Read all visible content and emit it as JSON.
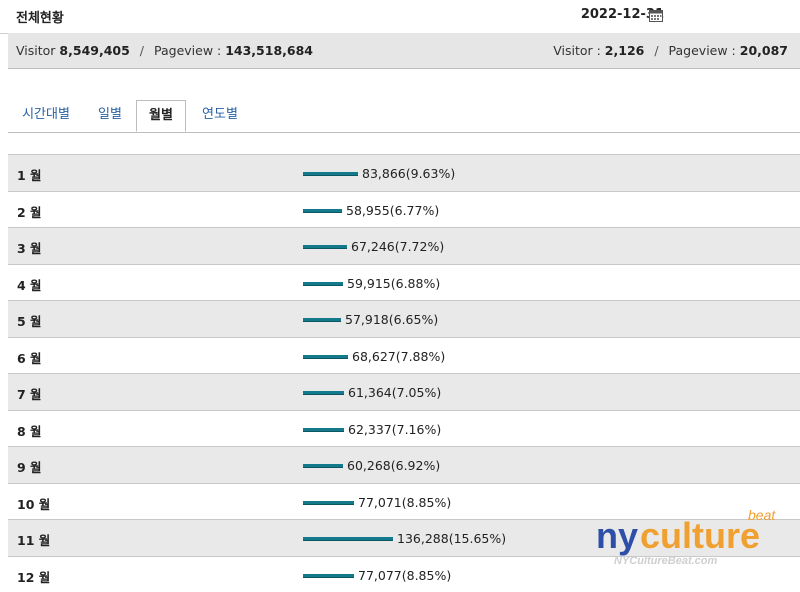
{
  "header": {
    "title": "전체현황",
    "date": "2022-12-31"
  },
  "summary": {
    "total_visitor_label": "Visitor",
    "total_visitor_value": "8,549,405",
    "total_pageview_label": "Pageview :",
    "total_pageview_value": "143,518,684",
    "today_visitor_label": "Visitor :",
    "today_visitor_value": "2,126",
    "today_pageview_label": "Pageview :",
    "today_pageview_value": "20,087",
    "separator": "/"
  },
  "tabs": [
    {
      "label": "시간대별",
      "active": false
    },
    {
      "label": "일별",
      "active": false
    },
    {
      "label": "월별",
      "active": true
    },
    {
      "label": "연도별",
      "active": false
    }
  ],
  "months": [
    {
      "label": "1 월",
      "value": "83,866(9.63%)",
      "share": 9.63
    },
    {
      "label": "2 월",
      "value": "58,955(6.77%)",
      "share": 6.77
    },
    {
      "label": "3 월",
      "value": "67,246(7.72%)",
      "share": 7.72
    },
    {
      "label": "4 월",
      "value": "59,915(6.88%)",
      "share": 6.88
    },
    {
      "label": "5 월",
      "value": "57,918(6.65%)",
      "share": 6.65
    },
    {
      "label": "6 월",
      "value": "68,627(7.88%)",
      "share": 7.88
    },
    {
      "label": "7 월",
      "value": "61,364(7.05%)",
      "share": 7.05
    },
    {
      "label": "8 월",
      "value": "62,337(7.16%)",
      "share": 7.16
    },
    {
      "label": "9 월",
      "value": "60,268(6.92%)",
      "share": 6.92
    },
    {
      "label": "10 월",
      "value": "77,071(8.85%)",
      "share": 8.85
    },
    {
      "label": "11 월",
      "value": "136,288(15.65%)",
      "share": 15.65
    },
    {
      "label": "12 월",
      "value": "77,077(8.85%)",
      "share": 8.85
    }
  ],
  "watermark": {
    "brand": "nyculture",
    "suffix": "beat",
    "site": "NYCultureBeat.com"
  },
  "colors": {
    "bar": "#137a8c",
    "tab_link": "#2a62a6",
    "row_alt": "#e9e9e9"
  }
}
